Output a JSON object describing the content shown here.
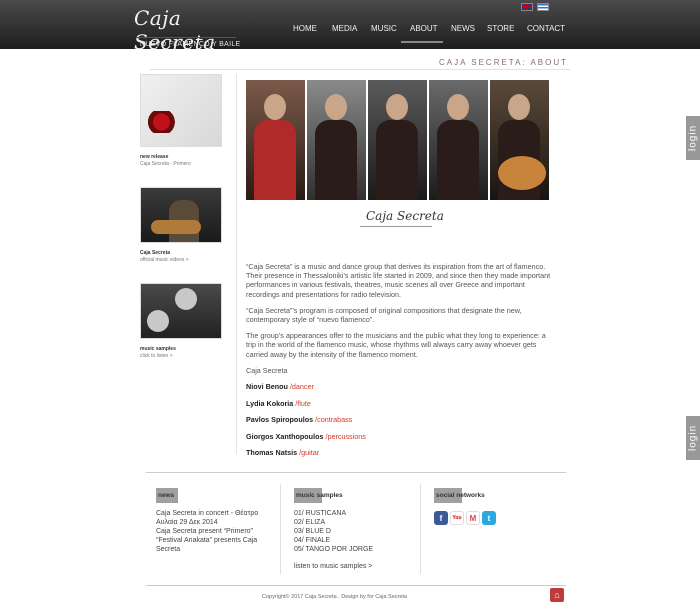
{
  "header": {
    "logo_script": "Caja Secreta",
    "logo_tagline": "NUEVO FLAMENCO Y BAILE",
    "nav": [
      "HOME",
      "MEDIA",
      "MUSIC",
      "ABOUT",
      "NEWS",
      "STORE",
      "CONTACT"
    ],
    "active_nav": "ABOUT",
    "flags": [
      "uk-flag-icon",
      "greek-flag-icon"
    ]
  },
  "page_heading": "CAJA SECRETA: ABOUT",
  "sidebar": [
    {
      "title": "new release",
      "subtitle": "Caja Secreta - Primero"
    },
    {
      "title": "Caja Secreta",
      "subtitle": "official music videos >"
    },
    {
      "title": "music samples",
      "subtitle": "click to listen >"
    }
  ],
  "signature": "Caja Secreta",
  "paragraphs": [
    "“Caja Secreta” is a music and dance group that derives its inspiration from the art of flamenco. Their presence in Thessaloniki’s artistic life started in 2009, and since then they made important performances in various festivals, theatres, music scenes all over Greece and important recordings and presentations for radio television.",
    "“Caja Secreta”’s program is composed of original compositions that designate the new, contemporary style of “nuevo flamenco”.",
    "The group’s appearances offer to the musicians and the public what they long to experience: a trip in the world of the flamenco music, whose rhythms will always carry away whoever gets carried away by the intensity of the flamenco moment.",
    "Caja Secreta"
  ],
  "members": [
    {
      "name": "Niovi Benou",
      "role": "/dancer"
    },
    {
      "name": "Lydia Kokoria",
      "role": "/flute"
    },
    {
      "name": "Pavlos Spiropoulos",
      "role": "/contrabass"
    },
    {
      "name": "Giorgos Xanthopoulos",
      "role": "/percussions"
    },
    {
      "name": "Thomas Natsis",
      "role": "/guitar"
    }
  ],
  "login_label": "login",
  "footer": {
    "news": {
      "heading": "news",
      "items": [
        "Caja Secreta in concert - Θέατρο Αυλαία 29 Δεκ 2014",
        "Caja Secreta present “Primero”",
        "“Festival Anakata” presents Caja Secreta"
      ]
    },
    "music": {
      "heading": "music samples",
      "items": [
        "01/ RUSTICANA",
        "02/ ELIZA",
        "03/ BLUE D",
        "04/ FINALE",
        "05/ TANGO POR JORGE"
      ],
      "link": "listen to music samples >"
    },
    "social": {
      "heading": "social networks",
      "icons": [
        "facebook-icon",
        "youtube-icon",
        "gmail-icon",
        "twitter-icon"
      ]
    }
  },
  "copyright": "Copyright© 2017 Caja Secreta . Design by  for Caja Secreta"
}
